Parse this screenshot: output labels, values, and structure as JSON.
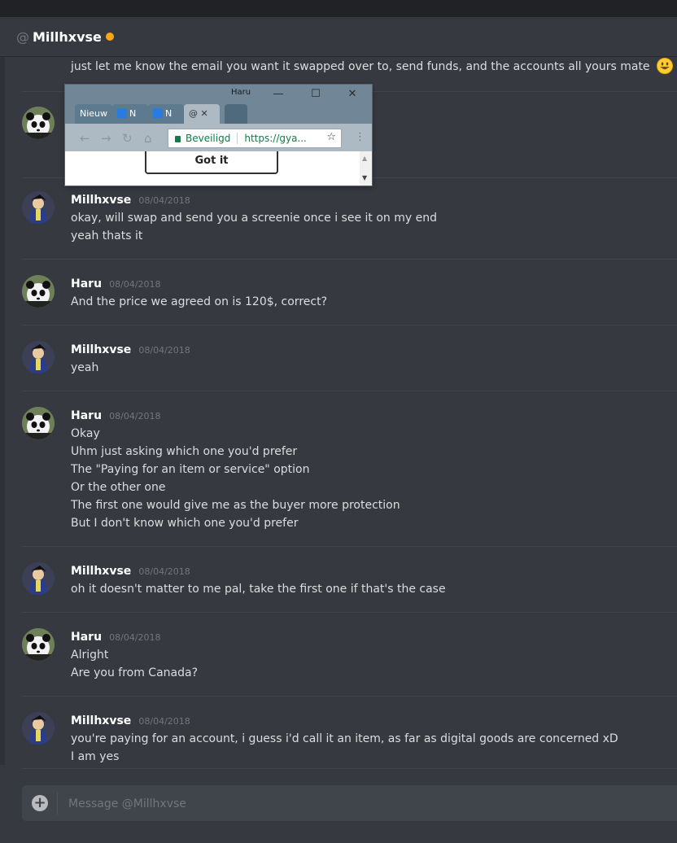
{
  "header": {
    "at": "@",
    "username": "Millhxvse",
    "status_color": "#faa61a"
  },
  "first_message": "just let me know the email you want it swapped over to, send funds, and the accounts all yours mate",
  "first_message_emoji": "smiley-emoji",
  "chrome_popup": {
    "window_title": "Haru",
    "tabs": [
      "Nieuw",
      "N",
      "N",
      "@"
    ],
    "secure_label": "Beveiligd",
    "url": "https://gya...",
    "button_label": "Got it"
  },
  "messages": [
    {
      "author": "Millhxvse",
      "timestamp": "08/04/2018",
      "avatar": "millhxvse-avatar",
      "lines": [
        "okay, will swap and send you a screenie once i see it on my end",
        "yeah thats it"
      ]
    },
    {
      "author": "Haru",
      "timestamp": "08/04/2018",
      "avatar": "haru-avatar",
      "lines": [
        "And the price we agreed on is 120$, correct?"
      ]
    },
    {
      "author": "Millhxvse",
      "timestamp": "08/04/2018",
      "avatar": "millhxvse-avatar",
      "lines": [
        "yeah"
      ]
    },
    {
      "author": "Haru",
      "timestamp": "08/04/2018",
      "avatar": "haru-avatar",
      "lines": [
        "Okay",
        "Uhm just asking which one you'd prefer",
        "The \"Paying for an item or service\" option",
        "Or the other one",
        "The first one would give me as the buyer more protection",
        "But I don't know which one you'd prefer"
      ]
    },
    {
      "author": "Millhxvse",
      "timestamp": "08/04/2018",
      "avatar": "millhxvse-avatar",
      "lines": [
        "oh it doesn't matter to me pal, take the first one if that's the case"
      ]
    },
    {
      "author": "Haru",
      "timestamp": "08/04/2018",
      "avatar": "haru-avatar",
      "lines": [
        "Alright",
        "Are you from Canada?"
      ]
    },
    {
      "author": "Millhxvse",
      "timestamp": "08/04/2018",
      "avatar": "millhxvse-avatar",
      "lines": [
        "you're paying for an account, i guess i'd call it an item, as far as digital goods are concerned xD",
        "I am yes"
      ]
    }
  ],
  "composer": {
    "placeholder": "Message @Millhxvse",
    "add_icon": "plus-circle-icon"
  }
}
